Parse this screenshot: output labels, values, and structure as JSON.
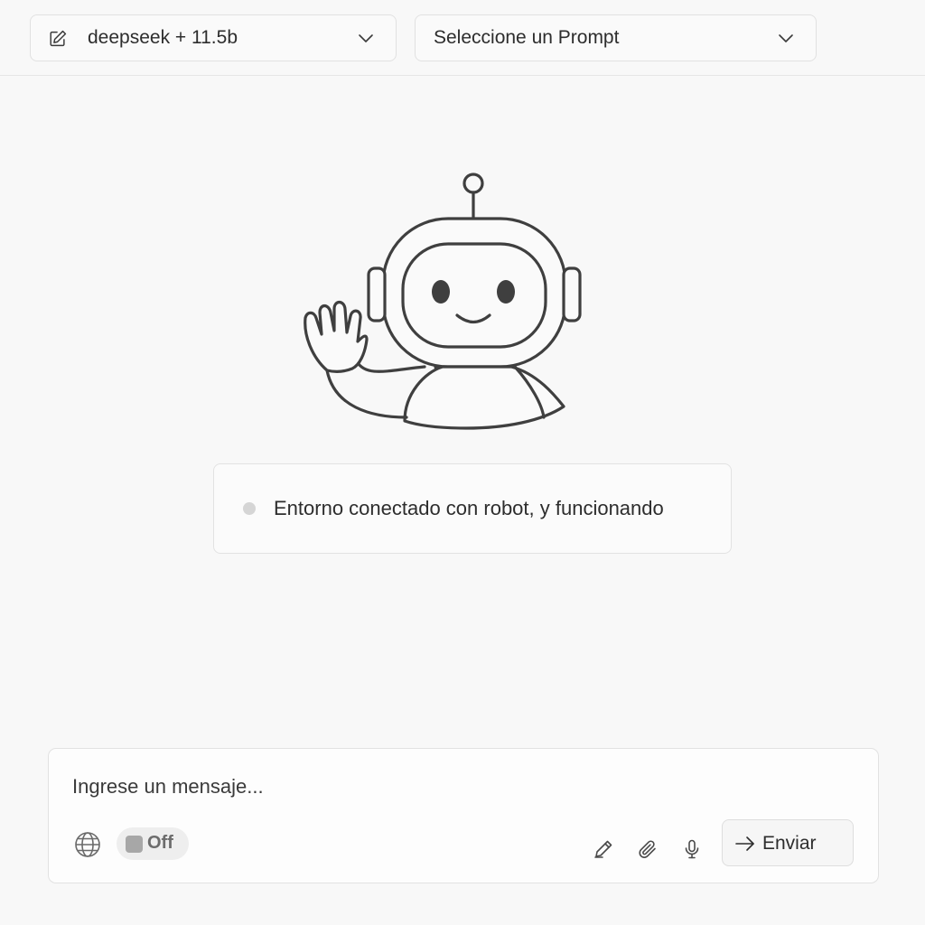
{
  "header": {
    "model_selector": {
      "value": "deepseek + 11.5b",
      "icon": "edit-icon"
    },
    "prompt_selector": {
      "value": "Seleccione un Prompt"
    }
  },
  "main": {
    "illustration": "waving-robot",
    "status": {
      "text": "Entorno conectado con robot, y funcionando",
      "dot_color": "#d5d5d5"
    }
  },
  "composer": {
    "placeholder": "Ingrese un mensaje...",
    "value": "",
    "web_toggle": {
      "label": "Off",
      "state": "off"
    },
    "tools": [
      "globe-icon",
      "pencil-icon",
      "paperclip-icon",
      "microphone-icon"
    ],
    "send_label": "Enviar"
  }
}
